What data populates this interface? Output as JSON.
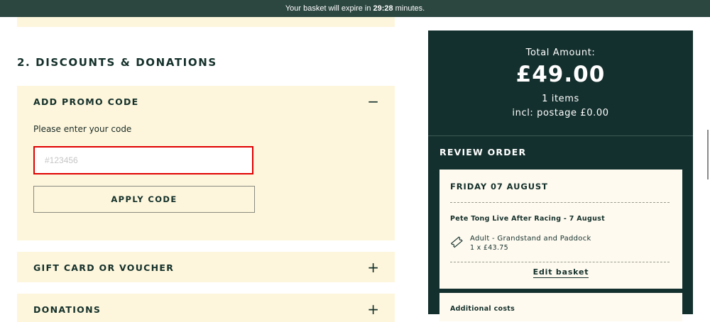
{
  "topbar": {
    "prefix": "Your basket will expire in",
    "time": "29:28",
    "suffix": "minutes."
  },
  "discounts": {
    "title": "2. DISCOUNTS & DONATIONS",
    "promo": {
      "heading": "ADD PROMO CODE",
      "toggle": "−",
      "label": "Please enter your code",
      "placeholder": "#123456",
      "value": "",
      "button": "APPLY CODE"
    },
    "gift": {
      "heading": "GIFT CARD OR VOUCHER",
      "toggle": "+"
    },
    "donations": {
      "heading": "DONATIONS",
      "toggle": "+"
    }
  },
  "summary": {
    "total_label": "Total Amount:",
    "total_amount": "£49.00",
    "items": "1 items",
    "postage": "incl: postage £0.00",
    "review_title": "REVIEW ORDER",
    "order": {
      "date": "FRIDAY 07 AUGUST",
      "event": "Pete Tong Live After Racing - 7 August",
      "ticket_name": "Adult - Grandstand and Paddock",
      "ticket_price": "1 x £43.75",
      "edit_link": "Edit basket"
    },
    "additional_costs": "Additional costs"
  },
  "icons": {
    "ticket": "ticket-icon",
    "minus": "minus-icon",
    "plus": "plus-icon"
  },
  "colors": {
    "topbar": "#2c4640",
    "summary_bg": "#14302e",
    "panel_bg": "#fdf6dc",
    "input_border": "#e00000"
  }
}
